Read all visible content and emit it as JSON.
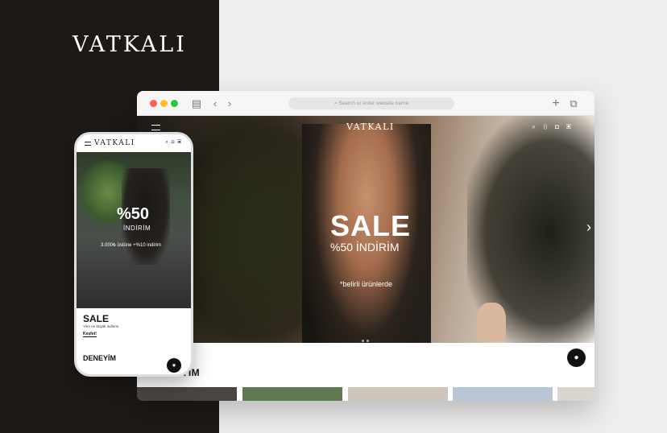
{
  "brand": {
    "logo": "VATKALI"
  },
  "browser": {
    "url_placeholder": "Search or enter website name",
    "icons": [
      "sidebar-icon",
      "back-chevron-icon",
      "forward-chevron-icon",
      "plus-icon",
      "tabs-icon"
    ]
  },
  "site": {
    "logo": "VATKALI",
    "hero": {
      "title": "SALE",
      "subtitle": "%50 İNDİRİM",
      "note": "*belirli ürünlerde"
    },
    "section_title": "DENEYİM"
  },
  "mobile": {
    "logo": "VATKALI",
    "hero": {
      "percent": "%50",
      "indirim": "İNDİRİM",
      "extra": "3.000₺ üstüne +%10 indirim"
    },
    "sale_title": "SALE",
    "sale_sub": "Yılın en büyük indirimi",
    "link": "Keşfet!",
    "section_title": "DENEYİM"
  },
  "colors": {
    "left_panel": "#1d1916",
    "right_panel": "#eeeeee"
  }
}
